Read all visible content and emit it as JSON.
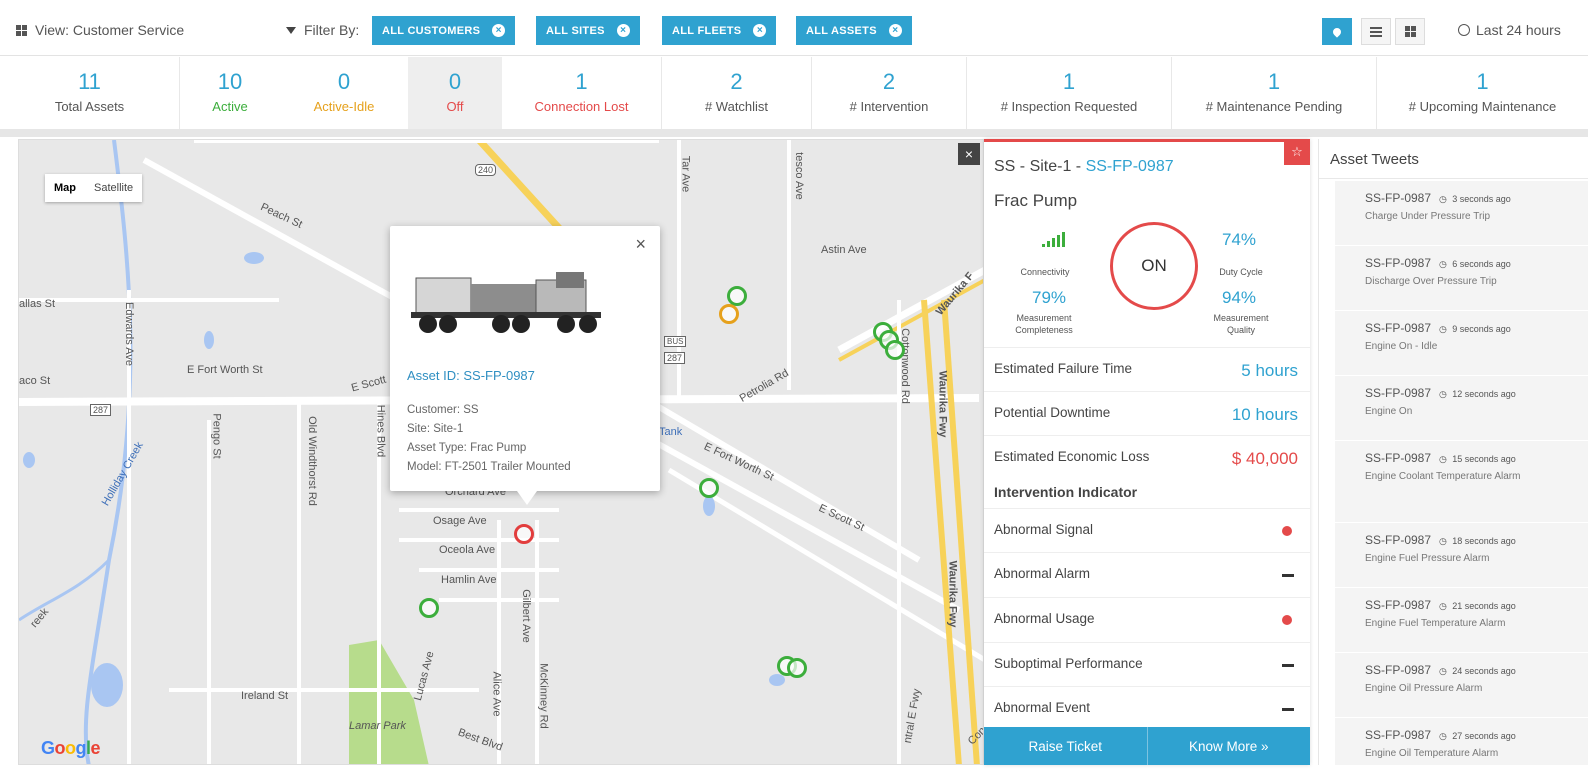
{
  "topbar": {
    "view_label": "View: Customer Service",
    "filter_label": "Filter By:",
    "filters": [
      "ALL CUSTOMERS",
      "ALL SITES",
      "ALL FLEETS",
      "ALL ASSETS"
    ],
    "time_range": "Last 24 hours"
  },
  "stats": [
    {
      "value": "11",
      "label": "Total Assets"
    },
    {
      "value": "10",
      "label": "Active"
    },
    {
      "value": "0",
      "label": "Active-Idle"
    },
    {
      "value": "0",
      "label": "Off"
    },
    {
      "value": "1",
      "label": "Connection Lost"
    },
    {
      "value": "2",
      "label": "# Watchlist"
    },
    {
      "value": "2",
      "label": "# Intervention"
    },
    {
      "value": "1",
      "label": "# Inspection Requested"
    },
    {
      "value": "1",
      "label": "# Maintenance Pending"
    },
    {
      "value": "1",
      "label": "# Upcoming Maintenance"
    }
  ],
  "colors": {
    "accent": "#2fa2d0",
    "active": "#3cae3c",
    "idle": "#e6a11c",
    "off": "#e44a4a",
    "lost": "#e44a4a"
  },
  "map": {
    "type_buttons": [
      "Map",
      "Satellite"
    ],
    "logo": "Google",
    "labels": {
      "peach": "Peach St",
      "astin": "Astin Ave",
      "dallas": "allas St",
      "edwards": "Edwards Ave",
      "efortworth1": "E Fort Worth St",
      "aco": "aco St",
      "escott1": "E Scott",
      "petrolia": "Petrolia Rd",
      "cottonwood": "Cottonwood Rd",
      "waurika1": "Waurika Fwy",
      "waurika2": "Waurika Fwy",
      "waurika3": "Waurika F",
      "holliday": "Holliday Creek",
      "pengo": "Pengo St",
      "oldwind": "Old Windthorst Rd",
      "hines": "Hines Blvd",
      "osage": "Osage Ave",
      "oceola": "Oceola Ave",
      "hamlin": "Hamlin Ave",
      "gilbert": "Gilbert Ave",
      "lucas": "Lucas Ave",
      "alice": "Alice Ave",
      "mckinney": "McKinney Rd",
      "ireland": "Ireland St",
      "lamar": "Lamar Park",
      "best": "Best Blvd",
      "tank": "Tank",
      "efortworth2": "E Fort Worth St",
      "escott2": "E Scott St",
      "reek": "reek",
      "ntral": "ntral E Fwy",
      "orchard": "Orchard Ave",
      "tar": "Tar Ave",
      "tesco": "tesco Ave",
      "road240": "240",
      "road287a": "287",
      "road287b": "287",
      "road287c": "287",
      "bus": "BUS",
      "con": "Con"
    },
    "popup": {
      "asset_id": "Asset ID: SS-FP-0987",
      "customer": "Customer: SS",
      "site": "Site: Site-1",
      "asset_type": "Asset Type: Frac Pump",
      "model": "Model: FT-2501 Trailer Mounted"
    }
  },
  "detail": {
    "title_prefix": "SS - Site-1 - ",
    "asset_id": "SS-FP-0987",
    "asset_type": "Frac Pump",
    "status": "ON",
    "connectivity_label": "Connectivity",
    "duty_cycle": "74%",
    "duty_cycle_label": "Duty Cycle",
    "measurement_completeness": "79%",
    "measurement_completeness_label": "Measurement Completeness",
    "measurement_quality": "94%",
    "measurement_quality_label": "Measurement Quality",
    "metrics": [
      {
        "label": "Estimated Failure Time",
        "value": "5 hours"
      },
      {
        "label": "Potential Downtime",
        "value": "10 hours"
      },
      {
        "label": "Estimated Economic Loss",
        "value": "$ 40,000"
      }
    ],
    "intervention_title": "Intervention Indicator",
    "indicators": [
      {
        "label": "Abnormal Signal",
        "state": "alert"
      },
      {
        "label": "Abnormal Alarm",
        "state": "none"
      },
      {
        "label": "Abnormal Usage",
        "state": "alert"
      },
      {
        "label": "Suboptimal Performance",
        "state": "none"
      },
      {
        "label": "Abnormal Event",
        "state": "none"
      }
    ],
    "raise_ticket": "Raise Ticket",
    "know_more": "Know More »"
  },
  "tweets": {
    "title": "Asset Tweets",
    "items": [
      {
        "asset": "SS-FP-0987",
        "ago": "3 seconds ago",
        "msg": "Charge Under Pressure Trip"
      },
      {
        "asset": "SS-FP-0987",
        "ago": "6 seconds ago",
        "msg": "Discharge Over Pressure Trip"
      },
      {
        "asset": "SS-FP-0987",
        "ago": "9 seconds ago",
        "msg": "Engine On - Idle"
      },
      {
        "asset": "SS-FP-0987",
        "ago": "12 seconds ago",
        "msg": "Engine On"
      },
      {
        "asset": "SS-FP-0987",
        "ago": "15 seconds ago",
        "msg": "Engine Coolant Temperature Alarm"
      },
      {
        "asset": "SS-FP-0987",
        "ago": "18 seconds ago",
        "msg": "Engine Fuel Pressure Alarm"
      },
      {
        "asset": "SS-FP-0987",
        "ago": "21 seconds ago",
        "msg": "Engine Fuel Temperature Alarm"
      },
      {
        "asset": "SS-FP-0987",
        "ago": "24 seconds ago",
        "msg": "Engine Oil Pressure Alarm"
      },
      {
        "asset": "SS-FP-0987",
        "ago": "27 seconds ago",
        "msg": "Engine Oil Temperature Alarm"
      }
    ]
  }
}
